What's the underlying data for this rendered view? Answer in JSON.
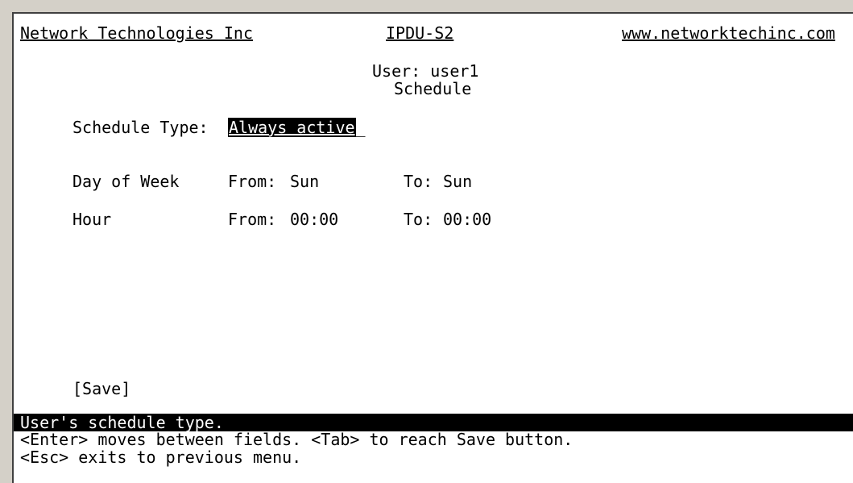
{
  "header": {
    "company": "Network Technologies Inc",
    "product": "IPDU-S2",
    "website": "www.networktechinc.com"
  },
  "title": {
    "user_line": "User: user1",
    "screen": "Schedule"
  },
  "schedule_type": {
    "label": "Schedule Type:",
    "value": "Always active",
    "cursor": "_"
  },
  "day_of_week": {
    "label": "Day of Week",
    "from_label": "From:",
    "from_value": "Sun",
    "to_label": "To:",
    "to_value": "Sun"
  },
  "hour": {
    "label": "Hour",
    "from_label": "From:",
    "from_value": "00:00",
    "to_label": "To:",
    "to_value": "00:00"
  },
  "save_button": "[Save]",
  "status": {
    "help": "User's schedule type.",
    "hint1": "<Enter> moves between fields. <Tab> to reach Save button.",
    "hint2": "<Esc> exits to previous menu."
  },
  "colors": {
    "background": "#ffffff",
    "text": "#000000",
    "highlight_bg": "#000000",
    "highlight_fg": "#ffffff",
    "window_frame": "#d4d0c8"
  }
}
